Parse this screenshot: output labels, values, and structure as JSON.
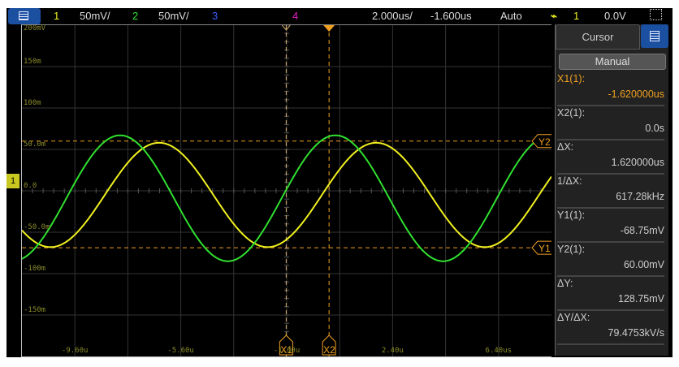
{
  "topbar": {
    "ch1": "1",
    "ch1_scale": "50mV/",
    "ch2": "2",
    "ch2_scale": "50mV/",
    "ch3": "3",
    "ch4": "4",
    "timebase": "2.000us/",
    "delay": "-1.600us",
    "trigger_mode": "Auto",
    "trigger_source": "1",
    "trigger_level": "0.0V",
    "icons": [
      "menu-icon",
      "trigger-edge-icon",
      "zoom-select-icon"
    ]
  },
  "colors": {
    "ch1": "#f0f020",
    "ch2": "#30e030",
    "ch3": "#3a5cff",
    "ch4": "#e020c0",
    "cursor": "#f0a020",
    "panel_accent": "#1b4fa0"
  },
  "panel": {
    "tab": "Cursor",
    "mode": "Manual",
    "rows": [
      {
        "key": "X1(1):",
        "value": "-1.620000us"
      },
      {
        "key": "X2(1):",
        "value": "0.0s"
      },
      {
        "key": "ΔX:",
        "value": "1.620000us"
      },
      {
        "key": "1/ΔX:",
        "value": "617.28kHz"
      },
      {
        "key": "Y1(1):",
        "value": "-68.75mV"
      },
      {
        "key": "Y2(1):",
        "value": "60.00mV"
      },
      {
        "key": "ΔY:",
        "value": "128.75mV"
      },
      {
        "key": "ΔY/ΔX:",
        "value": "79.4753kV/s"
      }
    ]
  },
  "markers": {
    "x1": "X1",
    "x2": "X2",
    "y1": "Y1",
    "y2": "Y2",
    "ground": "1"
  },
  "chart_data": {
    "type": "line",
    "xlim_us": [
      -11.6,
      8.4
    ],
    "ylim_mV": [
      -200,
      200
    ],
    "grid": true,
    "y_tick_labels": [
      "200mV",
      "150m",
      "100m",
      "50.0m",
      "0.0",
      "-50.0m",
      "-100m",
      "-150m"
    ],
    "y_tick_values": [
      200,
      150,
      100,
      50,
      0,
      -50,
      -100,
      -150
    ],
    "x_tick_labels": [
      "-9.60u",
      "-5.60u",
      "-1.60u",
      "2.40u",
      "6.40us"
    ],
    "x_tick_values": [
      -9.6,
      -5.6,
      -1.6,
      2.4,
      6.4
    ],
    "series": [
      {
        "channel": "1",
        "color": "#f0f020",
        "model": "sine",
        "amplitude_mV": 63,
        "offset_mV": -5,
        "period_us": 8.2,
        "peak_at_us": -6.42
      },
      {
        "channel": "2",
        "color": "#30e030",
        "model": "sine",
        "amplitude_mV": 76,
        "offset_mV": -9,
        "period_us": 8.13,
        "peak_at_us": -7.89
      }
    ],
    "cursors": {
      "x1_us": -1.62,
      "x2_us": 0,
      "y1_mV": -68.75,
      "y2_mV": 60
    }
  }
}
